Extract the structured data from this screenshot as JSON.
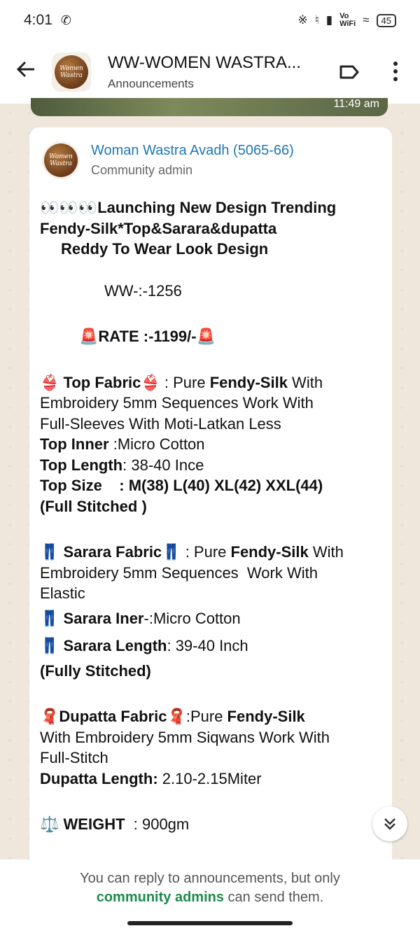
{
  "status": {
    "time": "4:01",
    "battery": "45",
    "vowifi_top": "Vo",
    "vowifi_bottom": "WiFi"
  },
  "header": {
    "title": "WW-WOMEN WASTRA...",
    "subtitle": "Announcements",
    "avatar_text_1": "Women",
    "avatar_text_2": "Wastra"
  },
  "previous": {
    "time": "11:49 am"
  },
  "sender": {
    "name": "Woman Wastra Avadh (5065-66)",
    "role": "Community admin"
  },
  "post": {
    "title_emoji": "👀👀👀",
    "title_1": "Launching New Design Trending",
    "title_2": "Fendy-Silk*Top&Sarara&dupatta",
    "title_3": "Reddy To Wear Look Design",
    "code": "WW-:-1256",
    "rate_emoji": "🚨",
    "rate": "RATE :-1199/-",
    "top_emoji": "👙",
    "top_fabric_label": "Top Fabric",
    "top_fabric_pre": " : Pure ",
    "top_fabric_bold": "Fendy-Silk",
    "top_fabric_post": " With",
    "top_fabric_2": "Embroidery 5mm Sequences Work With",
    "top_fabric_3": "Full-Sleeves With Moti-Latkan Less",
    "top_inner_label": "Top Inner",
    "top_inner_value": " :Micro Cotton",
    "top_length_label": "Top Length",
    "top_length_value": ": 38-40 Ince",
    "top_size_label": "Top Size",
    "top_size_value": "    : M(38) L(40) XL(42) XXL(44)",
    "top_stitched": "(Full Stitched )",
    "sarara_emoji": "👖",
    "sarara_fabric_label": "Sarara Fabric",
    "sarara_fabric_pre": " : Pure ",
    "sarara_fabric_bold": "Fendy-Silk",
    "sarara_fabric_post": " With",
    "sarara_fabric_2": "Embroidery 5mm Sequences  Work With",
    "sarara_fabric_3": "Elastic",
    "sarara_iner_label": "Sarara Iner",
    "sarara_iner_value": "-:Micro Cotton",
    "sarara_length_label": "Sarara Length",
    "sarara_length_value": ": 39-40 Inch",
    "sarara_stitched": "(Fully Stitched)",
    "dupatta_emoji": "🧣",
    "dupatta_fabric_label": "Dupatta Fabric",
    "dupatta_fabric_pre": ":Pure ",
    "dupatta_fabric_bold": "Fendy-Silk",
    "dupatta_fabric_2": "With Embroidery 5mm Siqwans Work With",
    "dupatta_fabric_3": "Full-Stitch",
    "dupatta_length_label": "Dupatta Length:",
    "dupatta_length_value": " 2.10-2.15Miter",
    "weight_emoji": "⚖️",
    "weight_label": "WEIGHT",
    "weight_value": "  : 900gm"
  },
  "footer": {
    "text_1": "You can reply to announcements, but only",
    "admins": "community admins",
    "text_2": " can send them."
  },
  "colors": {
    "sender": "#1f77b4",
    "admins": "#1f8a4c",
    "background": "#efe7dc"
  }
}
